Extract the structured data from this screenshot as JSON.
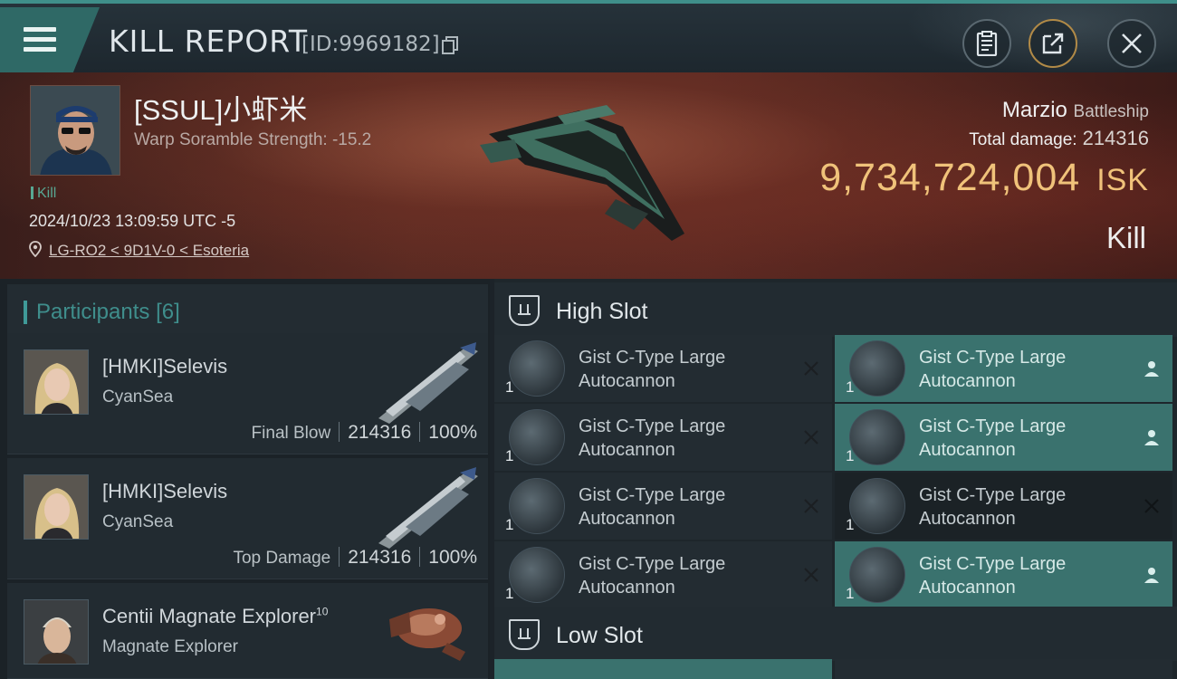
{
  "header": {
    "title": "KILL REPORT",
    "report_id": "[ID:9969182]",
    "icons": [
      "menu-icon",
      "copy-icon",
      "clipboard-icon",
      "share-icon",
      "close-icon"
    ]
  },
  "victim": {
    "name": "[SSUL]小虾米",
    "scramble": "Warp Soramble Strength: -15.2",
    "tag": "Kill",
    "timestamp": "2024/10/23 13:09:59 UTC -5",
    "location": "LG-RO2 < 9D1V-0 < Esoteria",
    "ship": "Marzio",
    "ship_class": "Battleship",
    "total_damage_label": "Total damage:",
    "total_damage": "214316",
    "isk_value": "9,734,724,004",
    "isk_unit": "ISK",
    "result": "Kill"
  },
  "participants": {
    "label": "Participants",
    "count": "[6]",
    "list": [
      {
        "name": "[HMKI]Selevis",
        "corp": "CyanSea",
        "role": "Final Blow",
        "damage": "214316",
        "percent": "100%"
      },
      {
        "name": "[HMKI]Selevis",
        "corp": "CyanSea",
        "role": "Top Damage",
        "damage": "214316",
        "percent": "100%"
      },
      {
        "name": "Centii Magnate Explorer",
        "level": "10",
        "corp": "Magnate Explorer"
      }
    ]
  },
  "slots": {
    "high_label": "High Slot",
    "low_label": "Low Slot",
    "high_modules": [
      {
        "line1": "Gist C-Type Large",
        "line2": "Autocannon",
        "qty": "1",
        "status": "destroyed"
      },
      {
        "line1": "Gist C-Type Large",
        "line2": "Autocannon",
        "qty": "1",
        "status": "dropped"
      },
      {
        "line1": "Gist C-Type Large",
        "line2": "Autocannon",
        "qty": "1",
        "status": "destroyed"
      },
      {
        "line1": "Gist C-Type Large",
        "line2": "Autocannon",
        "qty": "1",
        "status": "dropped"
      },
      {
        "line1": "Gist C-Type Large",
        "line2": "Autocannon",
        "qty": "1",
        "status": "destroyed"
      },
      {
        "line1": "Gist C-Type Large",
        "line2": "Autocannon",
        "qty": "1",
        "status": "destroyed"
      },
      {
        "line1": "Gist C-Type Large",
        "line2": "Autocannon",
        "qty": "1",
        "status": "destroyed"
      },
      {
        "line1": "Gist C-Type Large",
        "line2": "Autocannon",
        "qty": "1",
        "status": "dropped"
      }
    ]
  },
  "colors": {
    "accent_teal": "#3a726e",
    "isk_gold": "#f0c27a",
    "kill_green": "#58a893"
  }
}
